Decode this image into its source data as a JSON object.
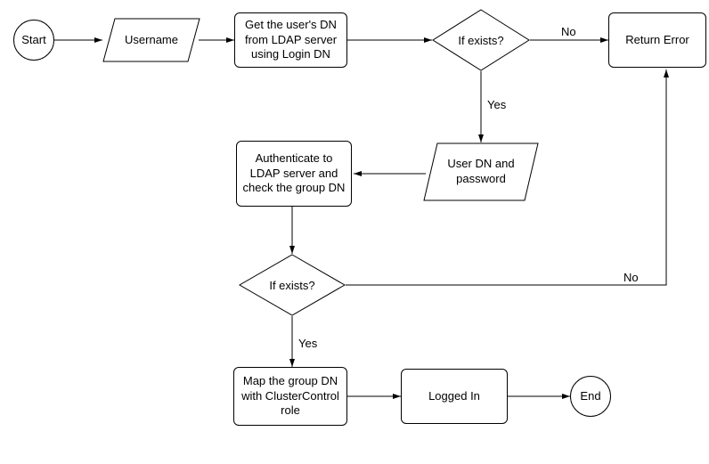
{
  "nodes": {
    "start": {
      "label": "Start"
    },
    "username": {
      "label": "Username"
    },
    "get_dn": {
      "label": "Get the user's DN from LDAP server using Login DN"
    },
    "exists1": {
      "label": "If exists?"
    },
    "return_error": {
      "label": "Return Error"
    },
    "user_dn_pw": {
      "label": "User DN and password"
    },
    "auth_group": {
      "label": "Authenticate to LDAP server and check the group DN"
    },
    "exists2": {
      "label": "If exists?"
    },
    "map_group": {
      "label": "Map the group DN with ClusterControl role"
    },
    "logged_in": {
      "label": "Logged In"
    },
    "end": {
      "label": "End"
    }
  },
  "edge_labels": {
    "exists1_no": "No",
    "exists1_yes": "Yes",
    "exists2_no": "No",
    "exists2_yes": "Yes"
  }
}
